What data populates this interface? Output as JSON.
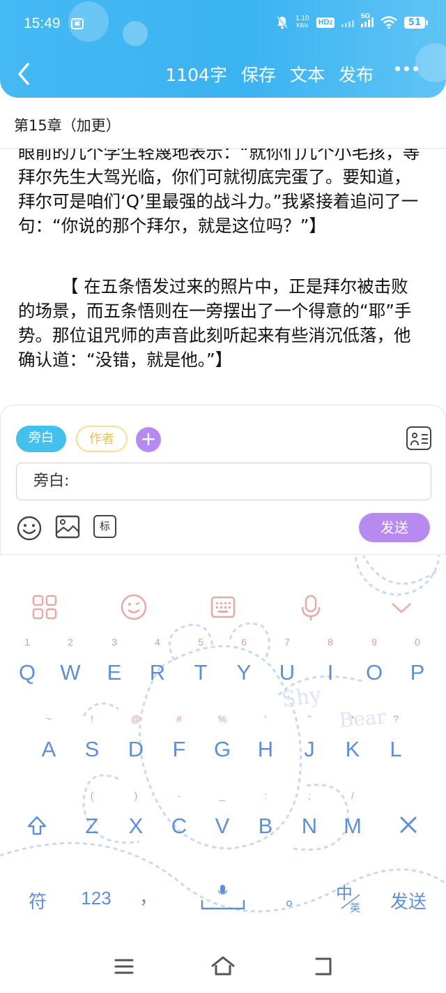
{
  "status_bar": {
    "time": "15:49",
    "net_speed_value": "1.10",
    "net_speed_unit": "KB/s",
    "hd_label": "HD",
    "hd_sub": "2",
    "network_type": "5G",
    "battery": "51"
  },
  "header": {
    "word_count": "1104字",
    "save_label": "保存",
    "text_label": "文本",
    "publish_label": "发布"
  },
  "chapter": {
    "title": "第15章（加更）"
  },
  "body": {
    "paragraph1": "眼前的几个学生轻蔑地表示：“就你们几个小毛孩，等拜尔先生大驾光临，你们可就彻底完蛋了。要知道，拜尔可是咱们‘Q’里最强的战斗力。”我紧接着追问了一句：“你说的那个拜尔，就是这位吗？”】",
    "paragraph2": "【 在五条悟发过来的照片中，正是拜尔被击败的场景，而五条悟则在一旁摆出了一个得意的“耶”手势。那位诅咒师的声音此刻听起来有些消沉低落，他确认道：“没错，就是他。”】"
  },
  "composer": {
    "role_narration": "旁白",
    "role_author": "作者",
    "add_symbol": "+",
    "input_value": "旁白:",
    "tag_label": "标",
    "send_label": "发送"
  },
  "keyboard": {
    "row1": [
      {
        "main": "Q",
        "alt": "1"
      },
      {
        "main": "W",
        "alt": "2"
      },
      {
        "main": "E",
        "alt": "3"
      },
      {
        "main": "R",
        "alt": "4"
      },
      {
        "main": "T",
        "alt": "5"
      },
      {
        "main": "Y",
        "alt": "6"
      },
      {
        "main": "U",
        "alt": "7"
      },
      {
        "main": "I",
        "alt": "8"
      },
      {
        "main": "O",
        "alt": "9"
      },
      {
        "main": "P",
        "alt": "0"
      }
    ],
    "row2": [
      {
        "main": "A",
        "alt": "~"
      },
      {
        "main": "S",
        "alt": "!"
      },
      {
        "main": "D",
        "alt": "@"
      },
      {
        "main": "F",
        "alt": "#"
      },
      {
        "main": "G",
        "alt": "%"
      },
      {
        "main": "H",
        "alt": "'"
      },
      {
        "main": "J",
        "alt": "\""
      },
      {
        "main": "K",
        "alt": "*"
      },
      {
        "main": "L",
        "alt": "?"
      }
    ],
    "row3": [
      {
        "main": "Z",
        "alt": "("
      },
      {
        "main": "X",
        "alt": ")"
      },
      {
        "main": "C",
        "alt": "-"
      },
      {
        "main": "V",
        "alt": "_"
      },
      {
        "main": "B",
        "alt": ":"
      },
      {
        "main": "N",
        "alt": ";"
      },
      {
        "main": "M",
        "alt": "/"
      }
    ],
    "symbols_label": "符",
    "numbers_label": "123",
    "comma_label": "，",
    "period_label": "。",
    "lang_zh": "中",
    "lang_en": "英",
    "send_label": "发送",
    "decor_text_1": "Shy",
    "decor_text_2": "Bear"
  },
  "colors": {
    "header_blue": "#3bb3f1",
    "narration_chip": "#43c1ec",
    "author_chip_border": "#f3df8d",
    "accent_purple": "#b78af0",
    "key_text": "#5d8fd8",
    "key_alt_text": "#e19a98"
  }
}
